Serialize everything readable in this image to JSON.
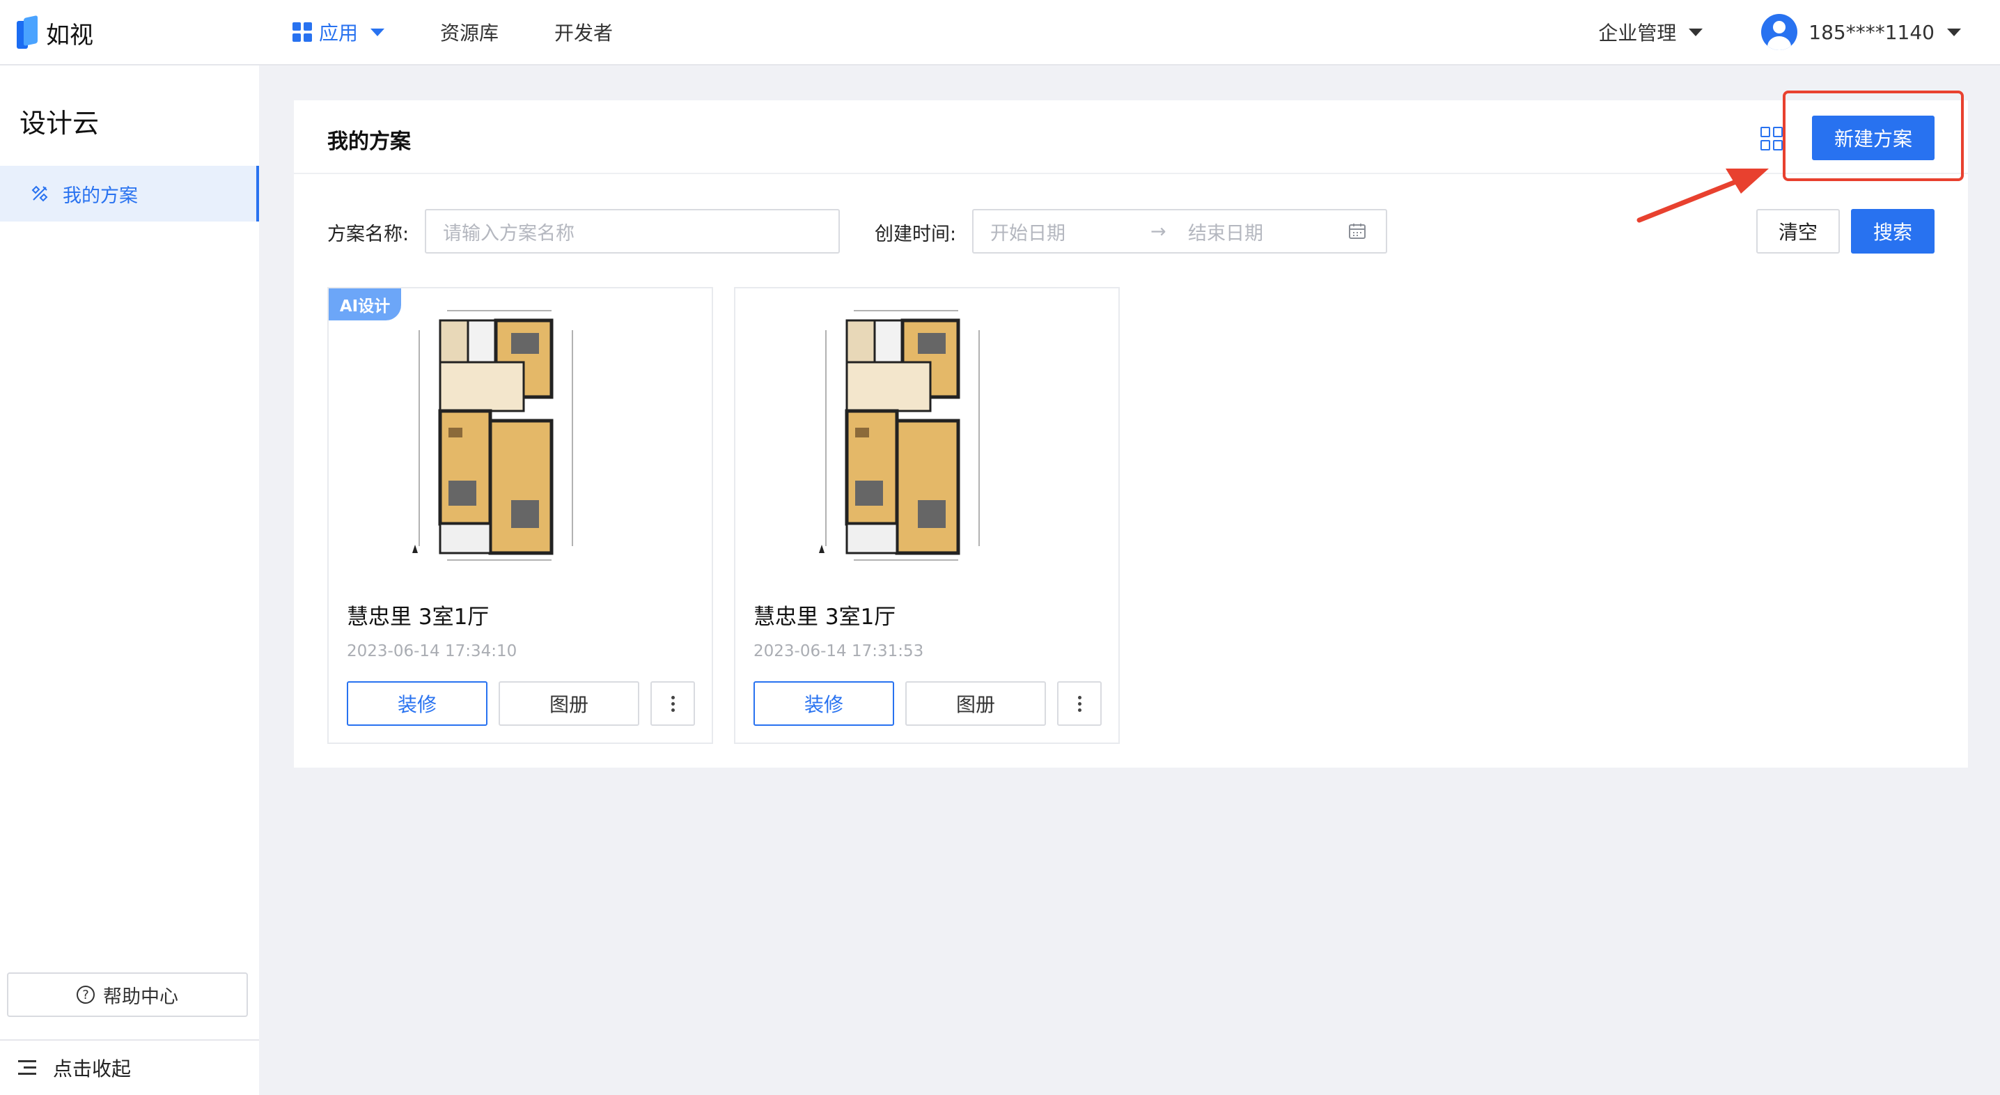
{
  "brand": {
    "name": "如视"
  },
  "nav": {
    "items": [
      {
        "label": "应用",
        "active": true
      },
      {
        "label": "资源库"
      },
      {
        "label": "开发者"
      }
    ],
    "enterprise": "企业管理",
    "user": "185****1140"
  },
  "sidebar": {
    "title": "设计云",
    "item": "我的方案",
    "help": "帮助中心",
    "collapse": "点击收起"
  },
  "panel": {
    "title": "我的方案",
    "new_button": "新建方案",
    "filter": {
      "name_label": "方案名称:",
      "name_placeholder": "请输入方案名称",
      "time_label": "创建时间:",
      "start_placeholder": "开始日期",
      "end_placeholder": "结束日期",
      "clear": "清空",
      "search": "搜索"
    },
    "cards": [
      {
        "badge": "AI设计",
        "name": "慧忠里 3室1厅",
        "time": "2023-06-14 17:34:10",
        "deco": "装修",
        "album": "图册"
      },
      {
        "name": "慧忠里 3室1厅",
        "time": "2023-06-14 17:31:53",
        "deco": "装修",
        "album": "图册"
      }
    ]
  },
  "colors": {
    "accent": "#2872f0",
    "annotation": "#e8412f",
    "badge": "#6ca6f8"
  }
}
